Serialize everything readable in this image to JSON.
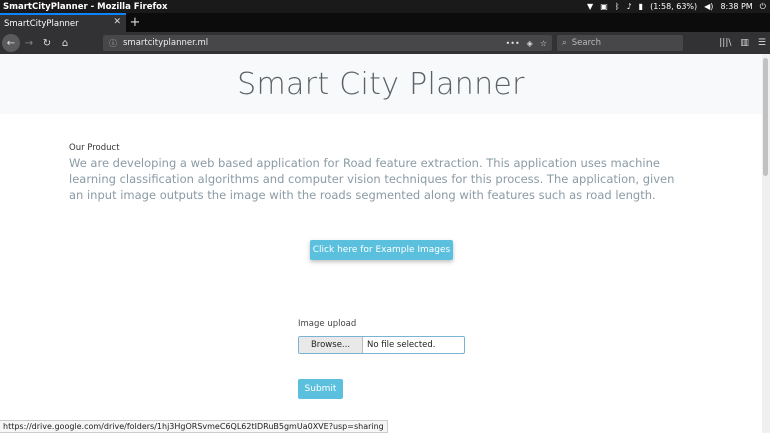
{
  "system_bar": {
    "window_title": "SmartCityPlanner - Mozilla Firefox",
    "battery": "(1:58, 63%)",
    "time": "8:38 PM"
  },
  "browser": {
    "tab_title": "SmartCityPlanner",
    "url": "smartcityplanner.ml",
    "search_placeholder": "Search",
    "status_url": "https://drive.google.com/drive/folders/1hj3HgORSvmeC6QL62tIDRuB5gmUa0XVE?usp=sharing"
  },
  "page": {
    "title": "Smart City Planner",
    "product_label": "Our Product",
    "product_description": "We are developing a web based application for Road feature extraction. This application uses machine learning classification algorithms and computer vision techniques for this process. The application, given an input image outputs the image with the roads segmented along with features such as road length.",
    "example_button": "Click here for Example Images",
    "upload_label": "Image upload",
    "browse_button": "Browse...",
    "file_status": "No file selected.",
    "submit_button": "Submit"
  },
  "icons": {
    "wifi": "wifi-icon",
    "keyboard": "keyboard-layout-icon",
    "bluetooth": "bluetooth-icon",
    "notifications": "bell-icon",
    "battery": "battery-icon",
    "volume": "volume-icon",
    "power": "power-icon"
  },
  "colors": {
    "accent": "#5bc0de",
    "tab_highlight": "#0a84ff"
  }
}
